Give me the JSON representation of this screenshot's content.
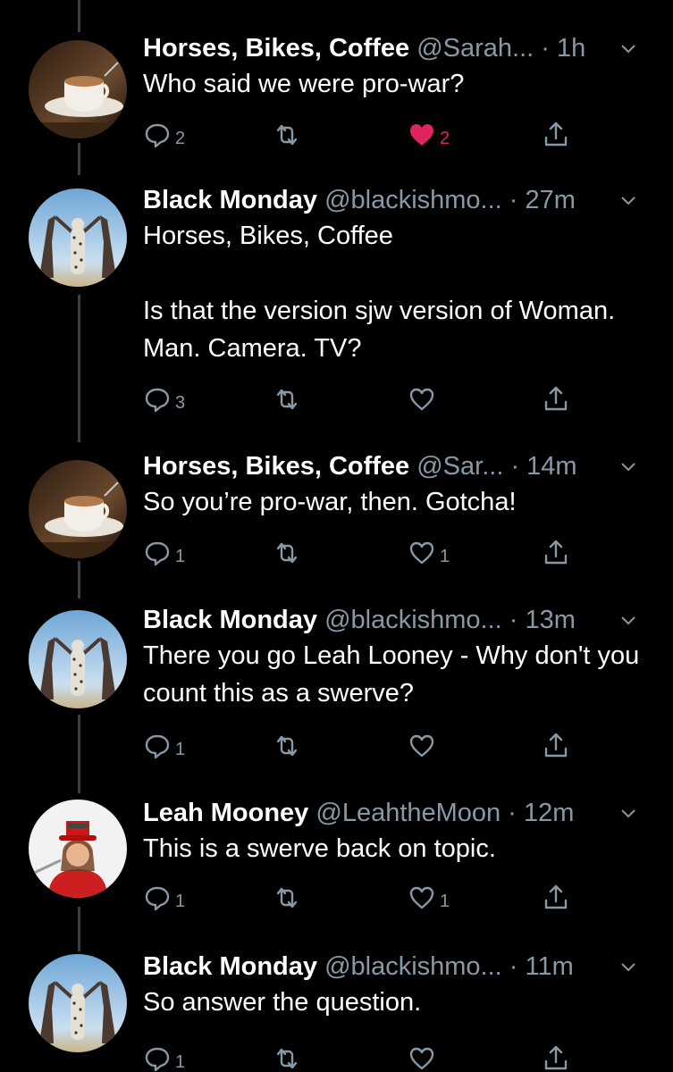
{
  "colors": {
    "background": "#000000",
    "muted": "#8899a6",
    "like_active": "#e0245e",
    "thread_line": "#3a3f44"
  },
  "icons": {
    "reply": "reply-icon",
    "retweet": "retweet-icon",
    "like": "heart-icon",
    "share": "share-icon",
    "menu": "chevron-down-icon"
  },
  "tweets": [
    {
      "name": "Horses, Bikes, Coffee",
      "handle": "@Sarah...",
      "dot": "·",
      "time": "1h",
      "text": "Who said we were pro-war?",
      "replies": "2",
      "retweets": "",
      "likes": "2",
      "liked": true
    },
    {
      "name": "Black Monday",
      "handle": "@blackishmo...",
      "dot": "·",
      "time": "27m",
      "text": "Horses, Bikes, Coffee\n\nIs that the version sjw version of Woman. Man. Camera. TV?",
      "replies": "3",
      "retweets": "",
      "likes": "",
      "liked": false
    },
    {
      "name": "Horses, Bikes, Coffee",
      "handle": "@Sar...",
      "dot": "·",
      "time": "14m",
      "text": "So you’re pro-war, then. Gotcha!",
      "replies": "1",
      "retweets": "",
      "likes": "1",
      "liked": false
    },
    {
      "name": "Black Monday",
      "handle": "@blackishmo...",
      "dot": "·",
      "time": "13m",
      "text": "There you go Leah Looney - Why don't you count this as a swerve?",
      "replies": "1",
      "retweets": "",
      "likes": "",
      "liked": false
    },
    {
      "name": "Leah Mooney",
      "handle": "@LeahtheMoon",
      "dot": "·",
      "time": "12m",
      "text": "This is a swerve back on topic.",
      "replies": "1",
      "retweets": "",
      "likes": "1",
      "liked": false
    },
    {
      "name": "Black Monday",
      "handle": "@blackishmo...",
      "dot": "·",
      "time": "11m",
      "text": "So answer the question.",
      "replies": "1",
      "retweets": "",
      "likes": "",
      "liked": false
    }
  ]
}
